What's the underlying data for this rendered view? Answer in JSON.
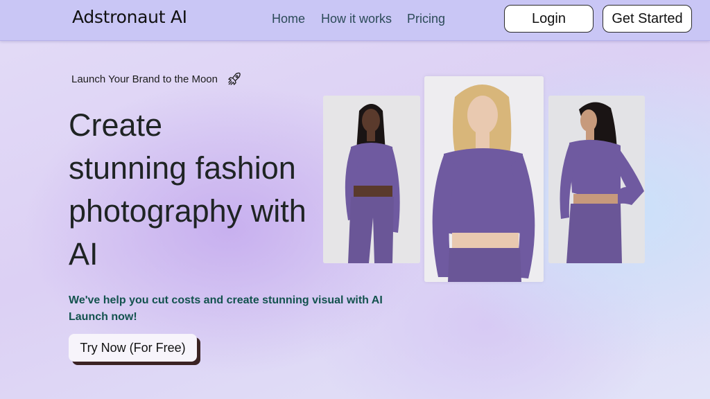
{
  "nav": {
    "brand": "Adstronaut AI",
    "links": [
      "Home",
      "How it works",
      "Pricing"
    ],
    "login_label": "Login",
    "get_started_label": "Get Started"
  },
  "hero": {
    "tagline": "Launch Your Brand to the Moon",
    "tagline_icon": "rocket-icon",
    "headline_lines": [
      "Create",
      "stunning fashion",
      "photography with",
      "AI"
    ],
    "subtext_lines": [
      "We've help you cut costs and create stunning visual with AI",
      "Launch now!"
    ],
    "cta_label": "Try Now (For Free)"
  },
  "gallery": [
    {
      "name": "model-photo-1",
      "outfit_color": "#6f5aa0",
      "hair_color": "#1a1414",
      "skin_color": "#5a3a2c"
    },
    {
      "name": "model-photo-2",
      "outfit_color": "#6f5aa0",
      "hair_color": "#d8b67a",
      "skin_color": "#e9c9b0"
    },
    {
      "name": "model-photo-3",
      "outfit_color": "#6f5aa0",
      "hair_color": "#1a1414",
      "skin_color": "#c79a7c"
    }
  ],
  "colors": {
    "navbar": "#c9c6f5",
    "accent_text": "#13524e",
    "nav_link_text": "#2c4a58",
    "outfit": "#6f5aa0"
  }
}
